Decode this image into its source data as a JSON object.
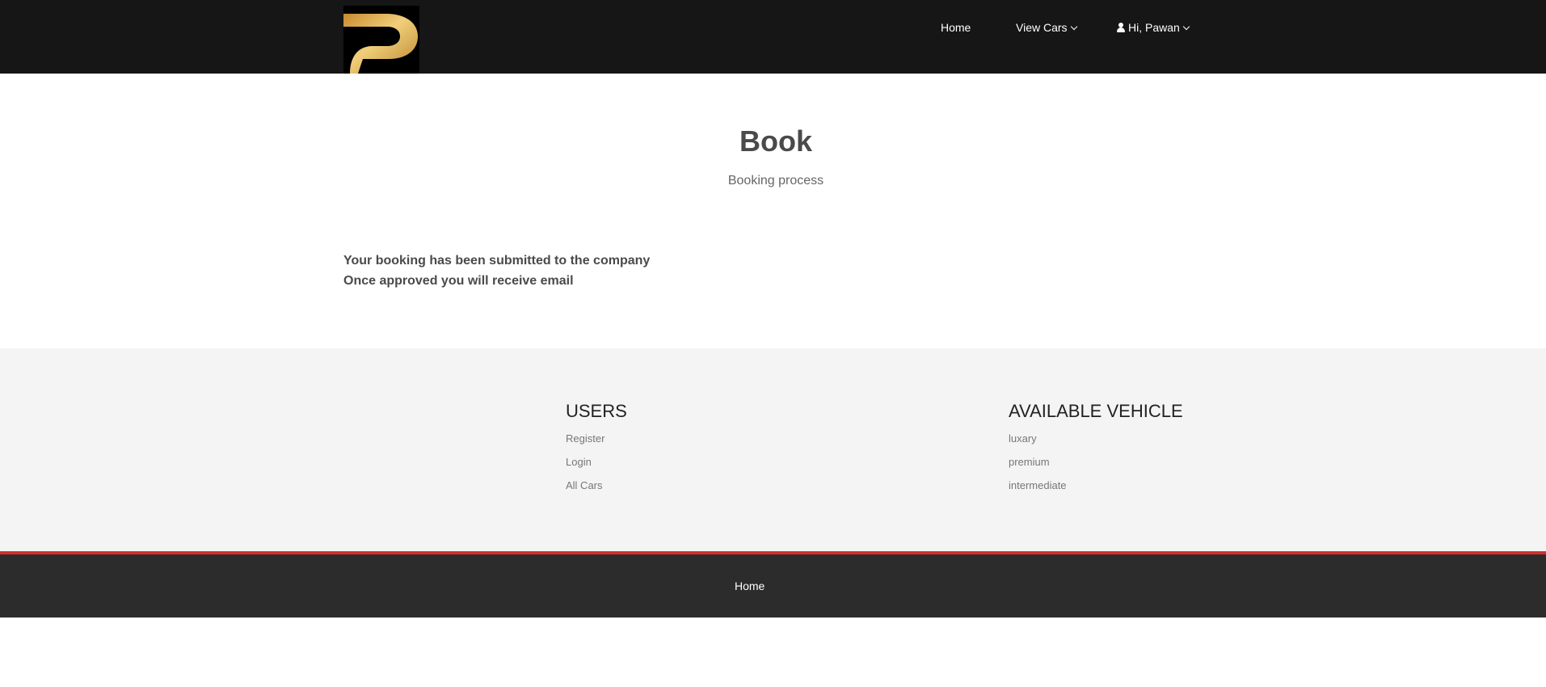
{
  "nav": {
    "logo_alt": "P",
    "home": "Home",
    "view_cars": "View Cars",
    "user": "Hi, Pawan"
  },
  "header": {
    "title": "Book",
    "subtitle": "Booking process"
  },
  "message": {
    "line1": "Your booking has been submitted to the company",
    "line2": "Once approved you will receive email"
  },
  "footer": {
    "users": {
      "heading": "USERS",
      "links": [
        "Register",
        "Login",
        "All Cars"
      ]
    },
    "vehicles": {
      "heading": "AVAILABLE VEHICLE",
      "links": [
        "luxary",
        "premium",
        "intermediate"
      ]
    }
  },
  "bottom": {
    "home": "Home"
  },
  "colors": {
    "navbar_bg": "#161616",
    "logo_gold": "#d8a94a",
    "footer_bg": "#f4f4f4",
    "accent_red": "#d32f2f",
    "bottom_bg": "#2c2c2c"
  }
}
